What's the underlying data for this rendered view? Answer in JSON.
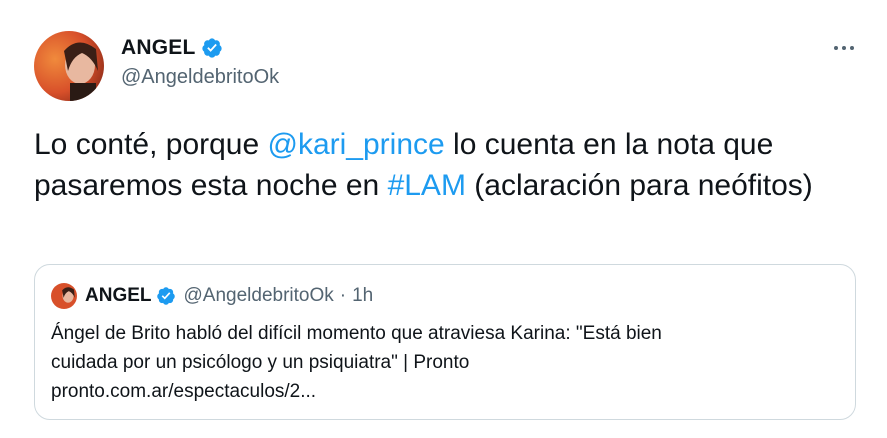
{
  "tweet": {
    "author_name": "ANGEL",
    "author_handle": "@AngeldebritoOk",
    "text_parts": {
      "t1": "Lo conté, porque ",
      "mention": "@kari_prince",
      "t2": " lo cuenta en la nota que pasaremos esta noche en ",
      "hashtag": "#LAM",
      "t3": " (aclaración para neófitos)"
    },
    "more_icon": "more-horizontal-icon"
  },
  "quote": {
    "author_name": "ANGEL",
    "author_handle": "@AngeldebritoOk",
    "separator": "·",
    "time": "1h",
    "line1": "Ángel de Brito habló del difícil momento que atraviesa Karina: \"Está bien",
    "line2": "cuidada por un psicólogo y un psiquiatra\" | Pronto",
    "line3": "pronto.com.ar/espectaculos/2..."
  },
  "colors": {
    "link": "#1d9bf0",
    "verified": "#1d9bf0",
    "secondary_text": "#536471",
    "border": "#cfd9de"
  }
}
